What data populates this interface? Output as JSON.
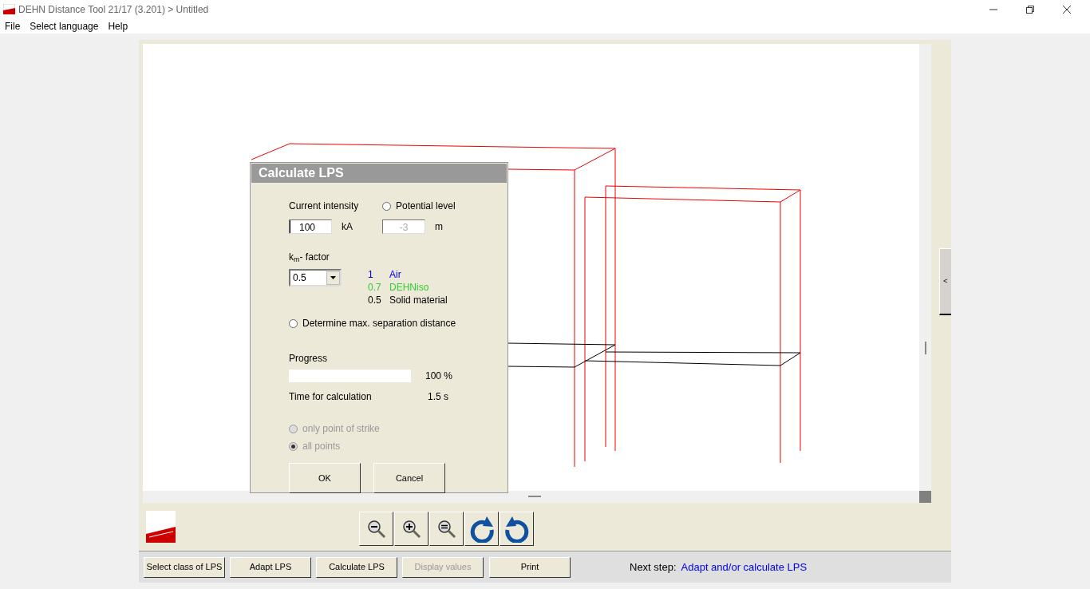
{
  "window": {
    "title": "DEHN Distance Tool 21/17 (3.201) > Untitled"
  },
  "menu": [
    "File",
    "Select language",
    "Help"
  ],
  "dialog": {
    "title": "Calculate LPS",
    "current_intensity": {
      "label": "Current intensity",
      "value": "100",
      "unit": "kA"
    },
    "potential_level": {
      "label": "Potential level",
      "selected": false,
      "value": "-3",
      "unit": "m",
      "disabled": true
    },
    "km_factor": {
      "label": "k$_{m}$- factor",
      "value": "0.5"
    },
    "km_legend": [
      {
        "value": "1",
        "material": "Air",
        "color": "#0000ff"
      },
      {
        "value": "0.7",
        "material": "DEHNiso",
        "color": "#33cc33"
      },
      {
        "value": "0.5",
        "material": "Solid material",
        "color": "#000000"
      }
    ],
    "max_separation": {
      "label": "Determine max. separation distance",
      "selected": false
    },
    "progress": {
      "label": "Progress",
      "level": 1,
      "reading": "100  %"
    },
    "time": {
      "label": "Time for calculation",
      "value": "1.5 s"
    },
    "scope": [
      {
        "label": "only point of strike",
        "selected": false,
        "disabled": true
      },
      {
        "label": "all points",
        "selected": true,
        "disabled": true
      }
    ],
    "buttons": [
      "OK",
      "Cancel"
    ]
  },
  "side_tab": {
    "label": "<"
  },
  "bottom_buttons": [
    {
      "label": "Select class of LPS",
      "disabled": false
    },
    {
      "label": "Adapt LPS",
      "disabled": false
    },
    {
      "label": "Calculate LPS",
      "disabled": false
    },
    {
      "label": "Display values",
      "disabled": true
    },
    {
      "label": "Print",
      "disabled": false
    }
  ],
  "status": {
    "label": "Next step:",
    "value": "Adapt and/or calculate LPS"
  }
}
